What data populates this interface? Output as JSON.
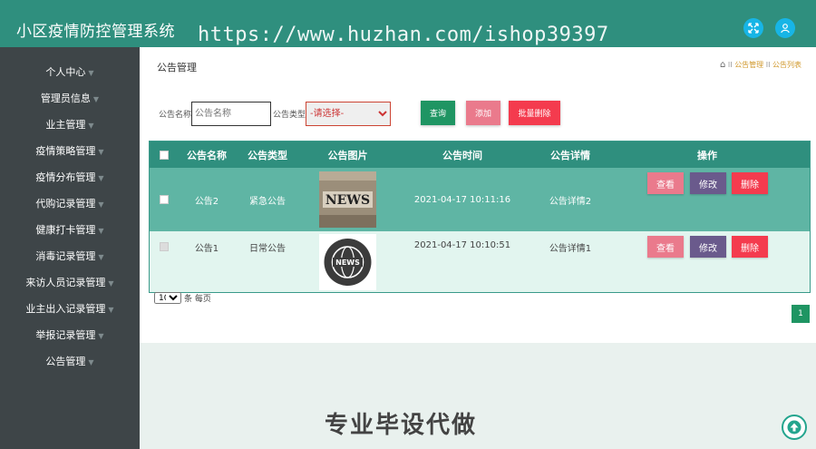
{
  "header": {
    "title": "小区疫情防控管理系统",
    "watermark_url": "https://www.huzhan.com/ishop39397",
    "icons": [
      "expand-icon",
      "user-icon"
    ]
  },
  "sidebar": {
    "items": [
      {
        "label": "个人中心"
      },
      {
        "label": "管理员信息"
      },
      {
        "label": "业主管理"
      },
      {
        "label": "疫情策略管理"
      },
      {
        "label": "疫情分布管理"
      },
      {
        "label": "代购记录管理"
      },
      {
        "label": "健康打卡管理"
      },
      {
        "label": "消毒记录管理"
      },
      {
        "label": "来访人员记录管理"
      },
      {
        "label": "业主出入记录管理"
      },
      {
        "label": "举报记录管理"
      },
      {
        "label": "公告管理"
      }
    ]
  },
  "main": {
    "title": "公告管理",
    "breadcrumb": [
      "公告管理",
      "公告列表"
    ],
    "search": {
      "name_label": "公告名称",
      "name_placeholder": "公告名称",
      "type_label": "公告类型",
      "type_selected": "-请选择-"
    },
    "buttons": {
      "query": "查询",
      "add": "添加",
      "batch_delete": "批量删除"
    },
    "table": {
      "headers": [
        "公告名称",
        "公告类型",
        "公告图片",
        "公告时间",
        "公告详情",
        "操作"
      ],
      "rows": [
        {
          "name": "公告2",
          "type": "紧急公告",
          "image": "NEWS",
          "time": "2021-04-17 10:11:16",
          "detail": "公告详情2"
        },
        {
          "name": "公告1",
          "type": "日常公告",
          "image": "NEWS",
          "time": "2021-04-17 10:10:51",
          "detail": "公告详情1"
        }
      ],
      "actions": {
        "view": "查看",
        "edit": "修改",
        "delete": "删除"
      }
    },
    "pagination": {
      "page_size": "10",
      "per_page_label": "条 每页",
      "current_page": "1"
    }
  },
  "overlay": {
    "promo_text": "专业毕设代做"
  },
  "colors": {
    "header": "#2f8f7e",
    "sidebar": "#3e4548",
    "row_selected": "#5fb5a4",
    "row_alt": "#e2f5ef",
    "primary": "#1f9563",
    "pink": "#ea7a8c",
    "danger": "#f43b4e",
    "purple": "#6a5a8c"
  }
}
